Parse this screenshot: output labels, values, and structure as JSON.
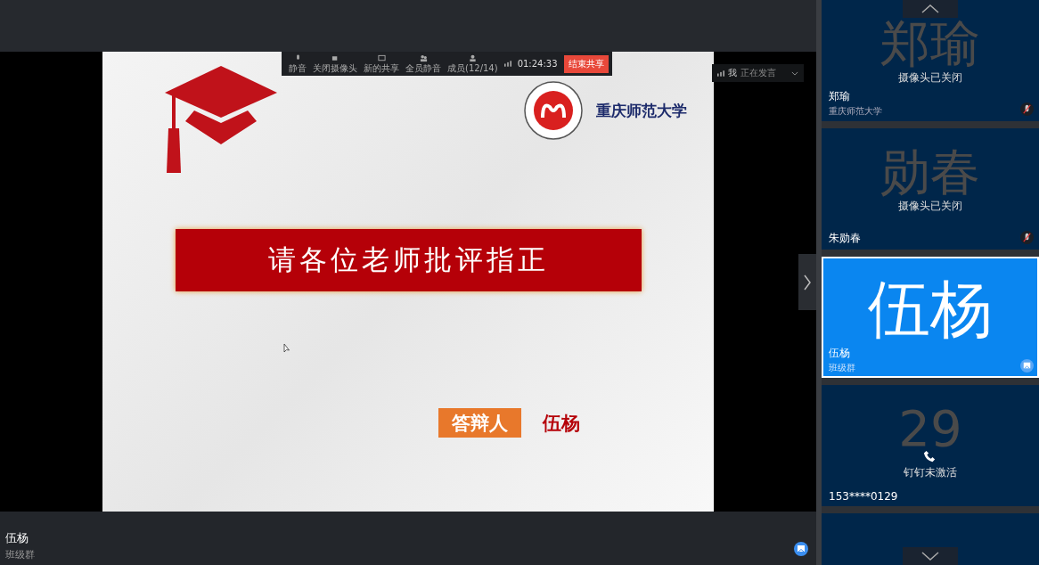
{
  "toolbar": {
    "buttons": [
      {
        "label": "静音",
        "kind": "mic"
      },
      {
        "label": "关闭摄像头",
        "kind": "camera"
      },
      {
        "label": "新的共享",
        "kind": "share"
      },
      {
        "label": "全员静音",
        "kind": "mute-all"
      },
      {
        "label": "成员(12/14)",
        "kind": "members"
      }
    ],
    "timer": "01:24:33",
    "end_button": "结束共享"
  },
  "speaking": {
    "name": "我",
    "status": "正在发言"
  },
  "slide": {
    "university": "重庆师范大学",
    "banner": "请各位老师批评指正",
    "presenter_label": "答辩人",
    "presenter_name": "伍杨"
  },
  "presenter_bar": {
    "name": "伍杨",
    "group": "班级群"
  },
  "participants": [
    {
      "kind": "camera-off",
      "avatar": "郑瑜",
      "status": "摄像头已关闭",
      "name": "郑瑜",
      "group": "重庆师范大学",
      "selected": false
    },
    {
      "kind": "camera-off",
      "avatar": "勋春",
      "status": "摄像头已关闭",
      "name": "朱勋春",
      "selected": false
    },
    {
      "kind": "sharing",
      "avatar": "伍杨",
      "name": "伍杨",
      "group": "班级群",
      "selected": true
    },
    {
      "kind": "phone",
      "avatar": "29",
      "status": "钉钉未激活",
      "name": "153****0129",
      "selected": false
    }
  ]
}
